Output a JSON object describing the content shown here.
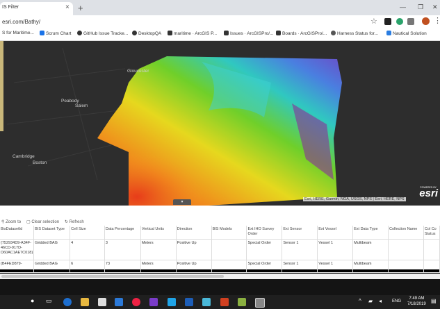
{
  "browser": {
    "tab_title": "IS Filter",
    "address": "esri.com/Bathy/",
    "bookmarks": [
      {
        "label": "S for Maritime...",
        "color": "#1a73e8"
      },
      {
        "label": "Scrum Chart",
        "color": "#1a73e8"
      },
      {
        "label": "GitHub Issue Tracke...",
        "color": "#333333"
      },
      {
        "label": "DesktopQA",
        "color": "#333333"
      },
      {
        "label": "maritime · ArcGIS P...",
        "color": "#333333"
      },
      {
        "label": "Issues · ArcGISPro/...",
        "color": "#333333"
      },
      {
        "label": "Boards · ArcGISPro/...",
        "color": "#333333"
      },
      {
        "label": "Harness Status for...",
        "color": "#555555"
      },
      {
        "label": "Nautical Solution",
        "color": "#2a7de1"
      }
    ]
  },
  "map": {
    "labels": [
      "Gloucester",
      "Peabody",
      "Salem",
      "Cambridge",
      "Boston"
    ],
    "logo": "esri",
    "powered_by": "POWERED BY",
    "attribution": "Esri, HERE, Garmin, NGA, USGS, NPS | Esri, HERE, NPS",
    "collapse_glyph": "▾"
  },
  "table_toolbar": {
    "zoom_to": "Zoom to",
    "clear_selection": "Clear selection",
    "refresh": "Refresh"
  },
  "table": {
    "columns": [
      "BisDatasetId",
      "BIS Dataset Type",
      "Cell Size",
      "Data Percentage",
      "Vertical Units",
      "Direction",
      "BIS Models",
      "Ext IHO Survey Order",
      "Ext Sensor",
      "Ext Vessel",
      "Ext Data Type",
      "Collection Name",
      "Col Co Status"
    ],
    "rows": [
      [
        "{752934D9-A34F-46CD-917D-D60AC1AE7C018}",
        "Gridded BAG",
        "4",
        "3",
        "Meters",
        "Positive Up",
        "",
        "Special Order",
        "Sensor 1",
        "Vessel 1",
        "Multibeam",
        "",
        ""
      ],
      [
        "{B4FED879-",
        "Gridded BAG",
        "6",
        "73",
        "Meters",
        "Positive Up",
        "",
        "Special Order",
        "Sensor 1",
        "Vessel 1",
        "Multibeam",
        "",
        ""
      ]
    ]
  },
  "taskbar": {
    "time": "7:49 AM",
    "date": "7/18/2019",
    "lang": "ENG"
  }
}
